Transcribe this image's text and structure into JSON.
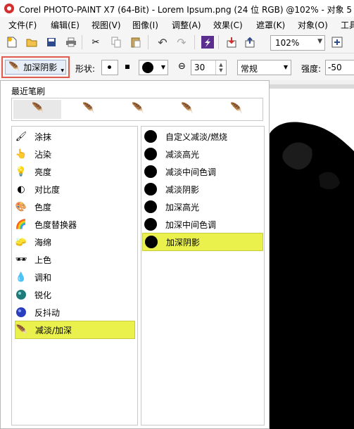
{
  "window": {
    "title": "Corel PHOTO-PAINT X7 (64-Bit) - Lorem Ipsum.png (24 位 RGB) @102% - 对象 5"
  },
  "menu": [
    "文件(F)",
    "编辑(E)",
    "视图(V)",
    "图像(I)",
    "调整(A)",
    "效果(C)",
    "遮罩(K)",
    "对象(O)",
    "工具"
  ],
  "toolbar": {
    "zoom": "102%"
  },
  "propertybar": {
    "brush_button_label": "加深阴影",
    "shape_label": "形状:",
    "size_value": "30",
    "mode_value": "常规",
    "strength_label": "强度:",
    "strength_value": "-50"
  },
  "panel": {
    "recent_label": "最近笔刷",
    "categories": [
      {
        "label": "涂抹",
        "icon": "smear-icon"
      },
      {
        "label": "沾染",
        "icon": "smudge-icon"
      },
      {
        "label": "亮度",
        "icon": "brightness-icon"
      },
      {
        "label": "对比度",
        "icon": "contrast-icon"
      },
      {
        "label": "色度",
        "icon": "hue-icon"
      },
      {
        "label": "色度替换器",
        "icon": "hue-replacer-icon"
      },
      {
        "label": "海绵",
        "icon": "sponge-icon"
      },
      {
        "label": "上色",
        "icon": "tint-icon"
      },
      {
        "label": "调和",
        "icon": "blend-icon"
      },
      {
        "label": "锐化",
        "icon": "sharpen-icon"
      },
      {
        "label": "反抖动",
        "icon": "undither-icon"
      },
      {
        "label": "减淡/加深",
        "icon": "dodge-burn-icon",
        "selected": true
      }
    ],
    "types": [
      {
        "label": "自定义减淡/燃烧"
      },
      {
        "label": "减淡高光"
      },
      {
        "label": "减淡中间色调"
      },
      {
        "label": "减淡阴影"
      },
      {
        "label": "加深高光"
      },
      {
        "label": "加深中间色调"
      },
      {
        "label": "加深阴影",
        "selected": true
      }
    ]
  },
  "colors": {
    "highlight": "#eaf04c",
    "focus_border": "#e05a4f",
    "app_red": "#d32f2f"
  }
}
